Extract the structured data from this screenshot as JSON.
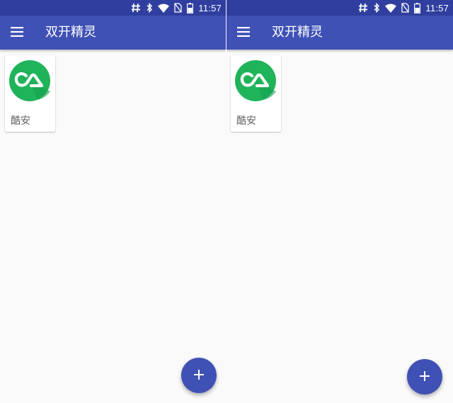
{
  "screens": [
    {
      "status_bar": {
        "time": "11:57",
        "icons": [
          "hash-icon",
          "bluetooth-icon",
          "wifi-icon",
          "no-sim-icon",
          "battery-icon"
        ]
      },
      "app_bar": {
        "title": "双开精灵",
        "menu_icon": "menu-icon"
      },
      "apps": [
        {
          "label": "酷安",
          "icon": "coolapk-icon"
        }
      ],
      "fab": {
        "icon": "plus-icon",
        "label": "+"
      }
    },
    {
      "status_bar": {
        "time": "11:57",
        "icons": [
          "hash-icon",
          "bluetooth-icon",
          "wifi-icon",
          "no-sim-icon",
          "battery-icon"
        ]
      },
      "app_bar": {
        "title": "双开精灵",
        "menu_icon": "menu-icon"
      },
      "apps": [
        {
          "label": "酷安",
          "icon": "coolapk-icon"
        }
      ],
      "fab": {
        "icon": "plus-icon",
        "label": "+"
      }
    }
  ],
  "colors": {
    "primary": "#3f51b5",
    "primary_dark": "#303f9f",
    "background": "#fafafa",
    "app_icon_green": "#1fb35a",
    "label_text": "#616161"
  }
}
